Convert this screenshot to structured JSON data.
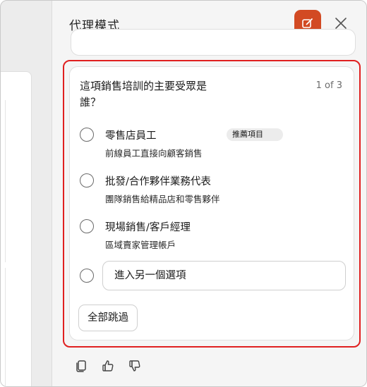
{
  "panel": {
    "title": "代理模式"
  },
  "question": {
    "text": "這項銷售培訓的主要受眾是誰？",
    "counter": "1 of 3"
  },
  "options": [
    {
      "label": "零售店員工",
      "description": "前線員工直接向顧客銷售",
      "badge": "推薦項目"
    },
    {
      "label": "批發/合作夥伴業務代表",
      "description": "團隊銷售給精品店和零售夥伴"
    },
    {
      "label": "現場銷售/客戶經理",
      "description": "區域賣家管理帳戶"
    }
  ],
  "other_option": {
    "placeholder": "進入另一個選項"
  },
  "skip_all_label": "全部跳過",
  "colors": {
    "accent": "#d24a23",
    "highlight": "#e02020"
  },
  "icons": {
    "new_chat": "compose-icon",
    "close": "close-icon",
    "copy": "copy-icon",
    "like": "thumbs-up-icon",
    "dislike": "thumbs-down-icon"
  }
}
